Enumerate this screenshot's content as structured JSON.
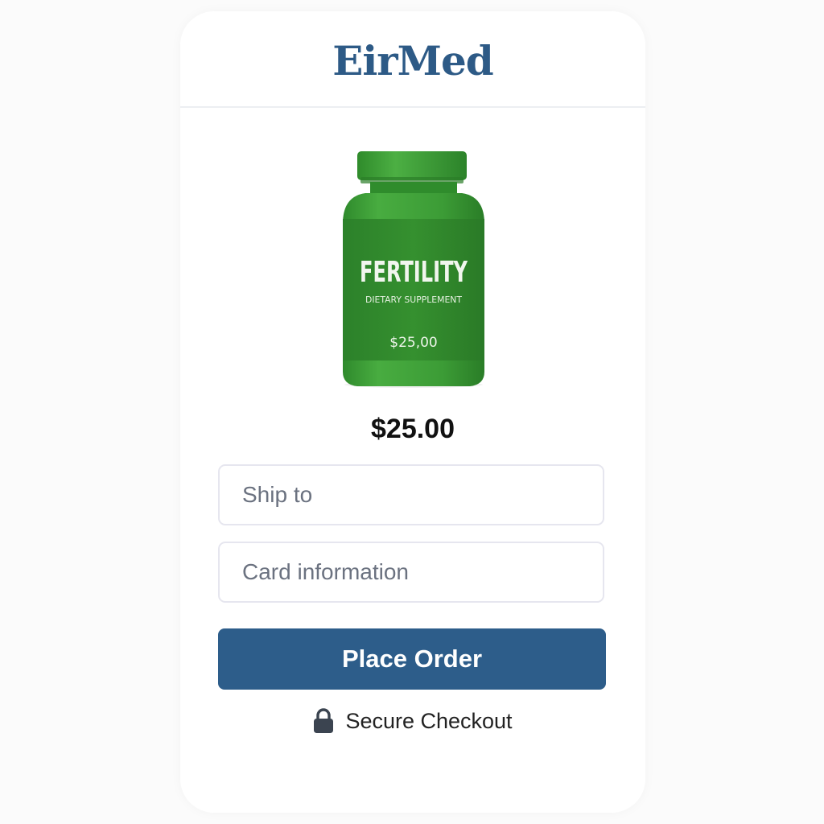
{
  "brand": {
    "name": "EirMed",
    "color": "#2d5a86"
  },
  "product": {
    "image_icon": "supplement-bottle",
    "label_title": "FERTILITY",
    "label_subtitle": "DIETARY SUPPLEMENT",
    "label_price": "$25,00",
    "bottle_color": "#3fa33a"
  },
  "price": "$25.00",
  "form": {
    "ship_placeholder": "Ship to",
    "card_placeholder": "Card information"
  },
  "actions": {
    "place_order_label": "Place Order",
    "button_color": "#2d5d8a"
  },
  "footer": {
    "secure_icon": "lock-icon",
    "secure_label": "Secure Checkout"
  }
}
